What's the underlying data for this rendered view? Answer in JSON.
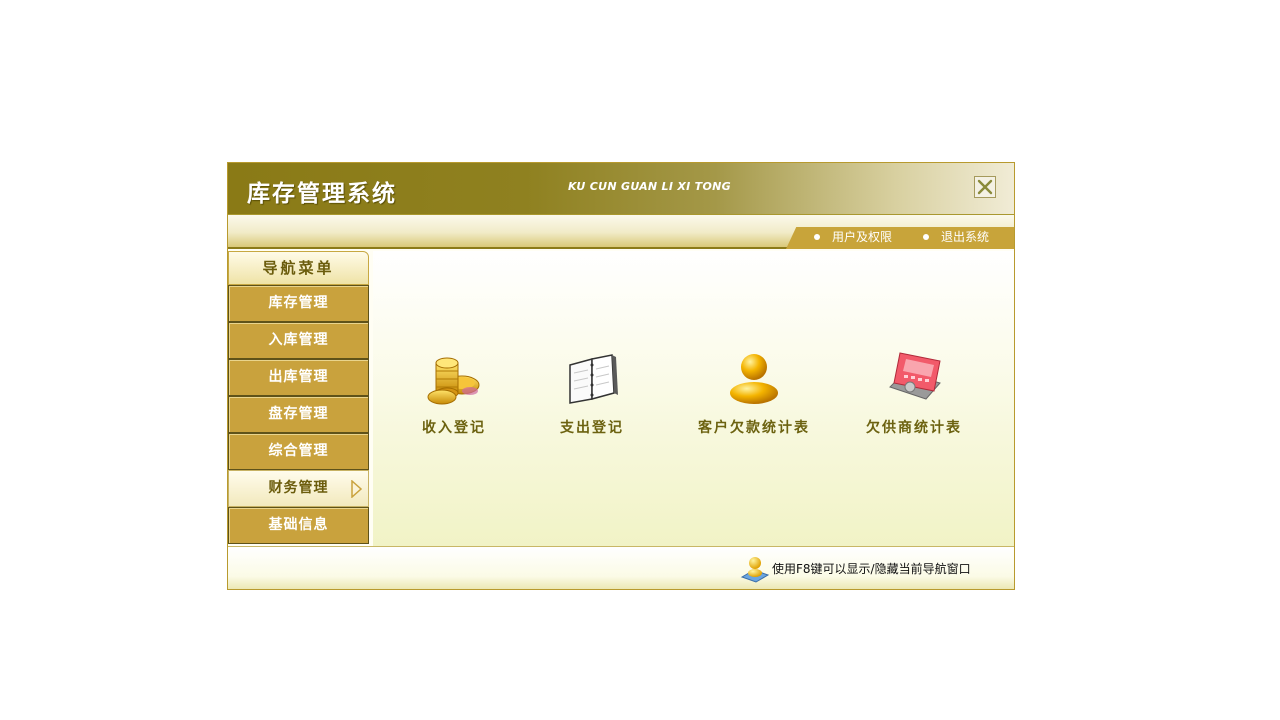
{
  "window": {
    "title": "库存管理系统",
    "subtitle": "KU CUN GUAN LI XI TONG"
  },
  "top_nav": [
    {
      "label": "用户及权限"
    },
    {
      "label": "退出系统"
    }
  ],
  "sidebar": {
    "header": "导航菜单",
    "items": [
      {
        "label": "库存管理",
        "active": false
      },
      {
        "label": "入库管理",
        "active": false
      },
      {
        "label": "出库管理",
        "active": false
      },
      {
        "label": "盘存管理",
        "active": false
      },
      {
        "label": "综合管理",
        "active": false
      },
      {
        "label": "财务管理",
        "active": true
      },
      {
        "label": "基础信息",
        "active": false
      }
    ]
  },
  "functions": [
    {
      "label": "收入登记",
      "icon": "coins-icon"
    },
    {
      "label": "支出登记",
      "icon": "notebook-icon"
    },
    {
      "label": "客户欠款统计表",
      "icon": "customer-icon"
    },
    {
      "label": "欠供商统计表",
      "icon": "calculator-icon"
    }
  ],
  "status": {
    "tip": "使用F8键可以显示/隐藏当前导航窗口",
    "icon": "user-tip-icon"
  },
  "colors": {
    "title_bar": "#8a7a16",
    "nav_item": "#c9a23d",
    "label_text": "#6c6210",
    "accent_border": "#b89a2e"
  }
}
